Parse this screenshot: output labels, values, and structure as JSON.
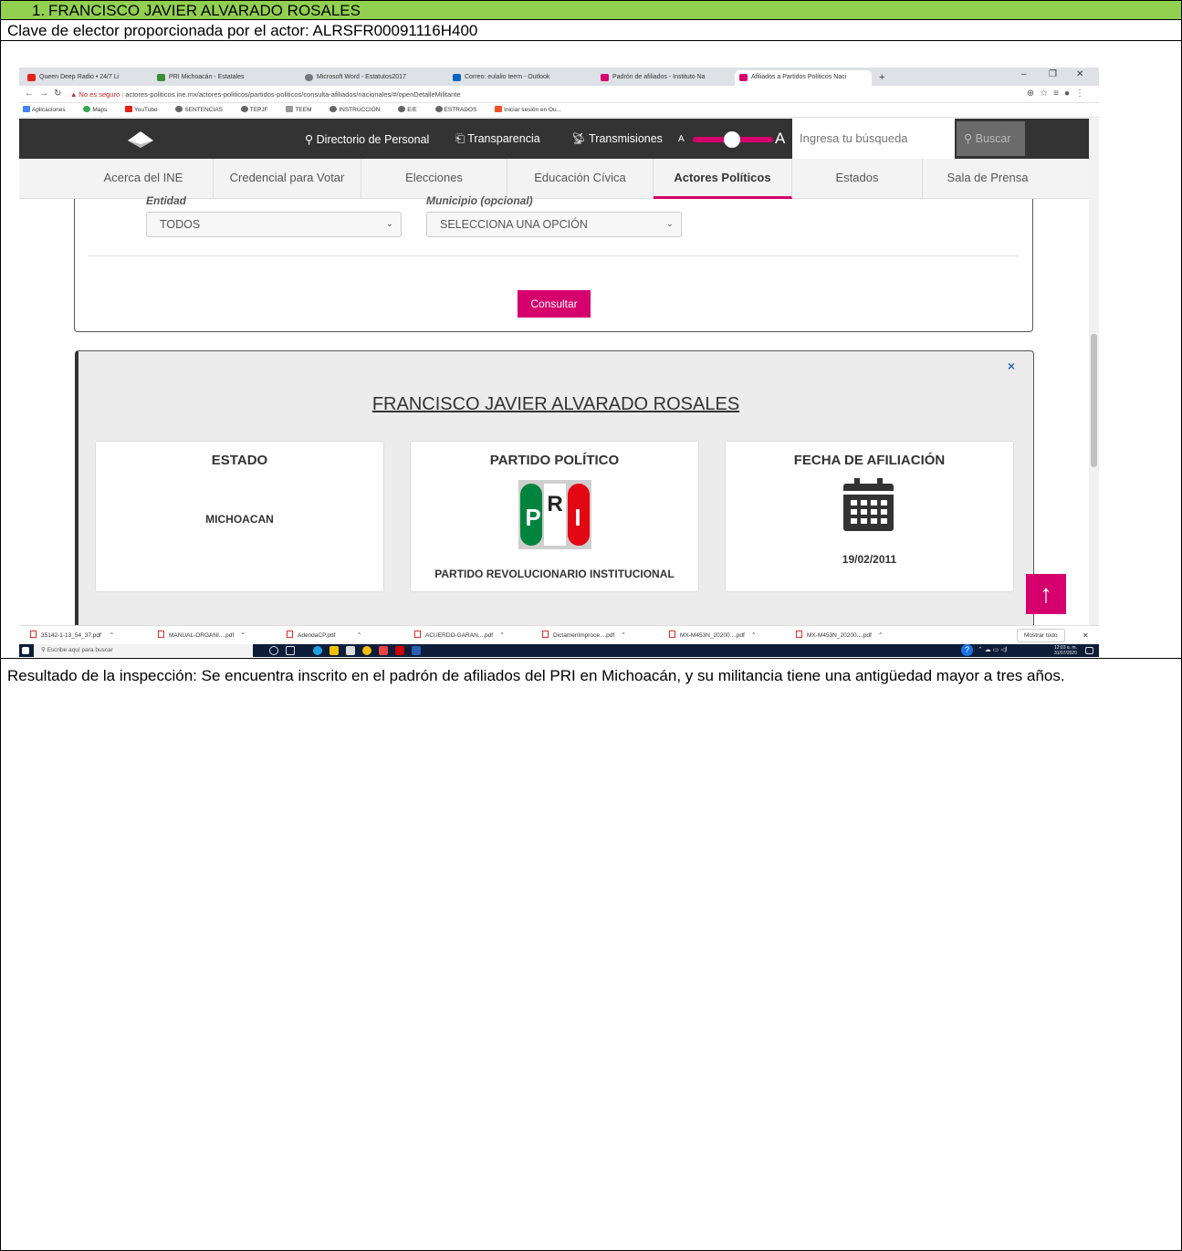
{
  "title_row": {
    "number": "1.",
    "name": "FRANCISCO JAVIER ALVARADO ROSALES"
  },
  "clave_row": "Clave de elector proporcionada por el actor: ALRSFR00091116H400",
  "browser": {
    "tabs": [
      {
        "label": "Queen Deep Radio • 24/7 Li"
      },
      {
        "label": "PRI Michoacán - Estatales"
      },
      {
        "label": "Microsoft Word - Estatutos2017"
      },
      {
        "label": "Correo: eulalio teem - Outlook"
      },
      {
        "label": "Padrón de afiliados - Instituto Na"
      },
      {
        "label": "Afiliados a Partidos Políticos Naci"
      }
    ],
    "new_tab": "+",
    "security": "No es seguro",
    "url": "actores-politicos.ine.mx/actores-politicos/partidos-politicos/consulta-afiliados/nacionales/#/openDetalleMilitante",
    "bookmarks": [
      "Aplicaciones",
      "Maps",
      "YouTube",
      "SENTENCIAS",
      "TEPJF",
      "TEEM",
      "INSTRUCCIÓN",
      "E/E",
      "ESTRADOS",
      "Iniciar sesión en Ou..."
    ]
  },
  "ine": {
    "top_links": [
      "Directorio de Personal",
      "Transparencia",
      "Transmisiones"
    ],
    "font_small": "A",
    "font_big": "A",
    "search_placeholder": "Ingresa tu búsqueda",
    "search_button": "Buscar",
    "menu": [
      {
        "label": "Acerca del INE"
      },
      {
        "label": "Credencial para Votar"
      },
      {
        "label": "Elecciones"
      },
      {
        "label": "Educación Cívica"
      },
      {
        "label": "Actores Políticos"
      },
      {
        "label": "Estados"
      },
      {
        "label": "Sala de Prensa"
      }
    ],
    "active_menu": "Actores Políticos"
  },
  "form": {
    "entidad_label": "Entidad",
    "municipio_label": "Municipio (opcional)",
    "entidad_value": "TODOS",
    "municipio_value": "SELECCIONA UNA OPCIÓN",
    "consultar": "Consultar"
  },
  "result": {
    "close": "×",
    "name": "FRANCISCO JAVIER ALVARADO ROSALES",
    "estado_header": "ESTADO",
    "estado_value": "MICHOACAN",
    "partido_header": "PARTIDO POLÍTICO",
    "partido_value": "PARTIDO REVOLUCIONARIO INSTITUCIONAL",
    "fecha_header": "FECHA DE AFILIACIÓN",
    "fecha_value": "19/02/2011"
  },
  "downloads": [
    "35142-1-13_54_37.pdf",
    "MANUAL-ORGANI....pdf",
    "AdendaCP.pdf",
    "ACUERDO-GARAN....pdf",
    "DictamenImproce....pdf",
    "MX-M453N_20200....pdf",
    "MX-M453N_20200....pdf"
  ],
  "show_all": "Mostrar todo",
  "taskbar": {
    "search_placeholder": "Escribe aquí para buscar",
    "time": "12:03 a. m.",
    "date": "31/07/2020"
  },
  "result_row": "Resultado de la inspección: Se encuentra inscrito en el padrón de afiliados del PRI en Michoacán, y su militancia tiene una antigüedad mayor a tres años.",
  "colors": {
    "header_green": "#92d050",
    "ine_pink": "#d5006d",
    "ine_dark": "#333333"
  }
}
